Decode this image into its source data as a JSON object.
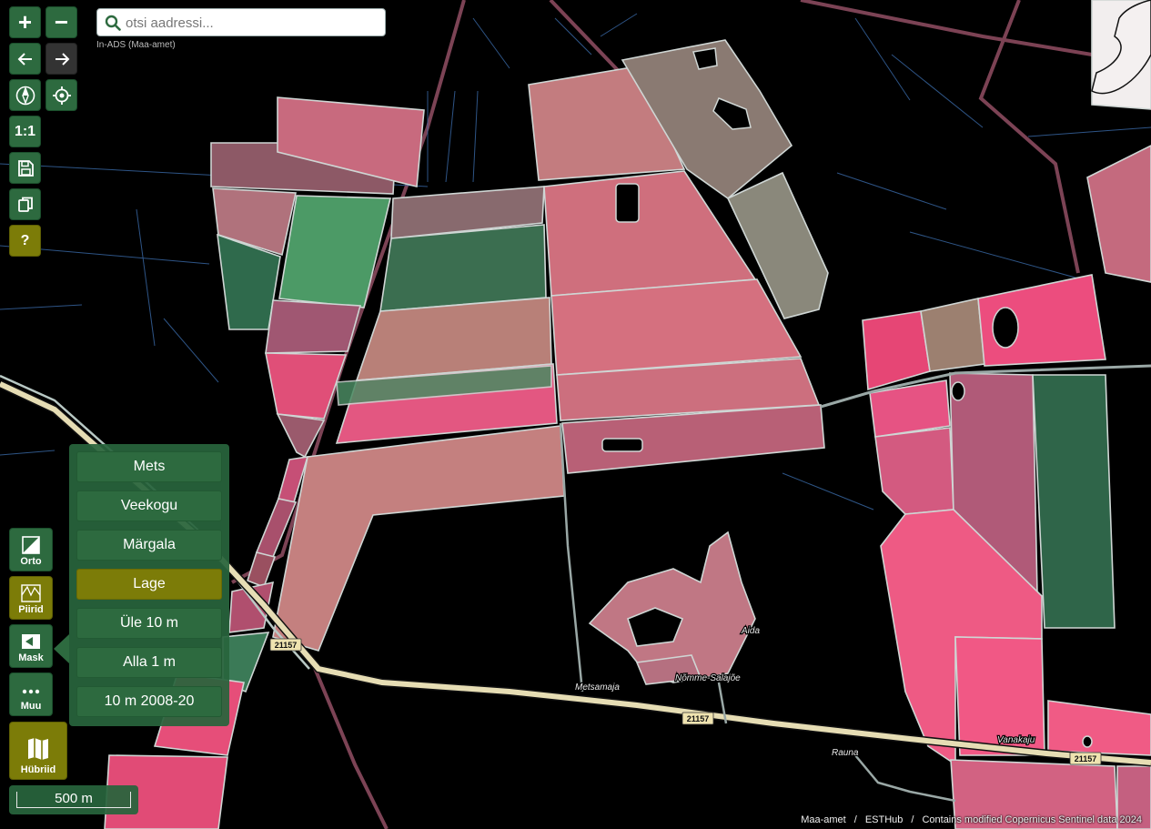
{
  "search": {
    "placeholder": "otsi aadressi...",
    "source_label": "In-ADS (Maa-amet)"
  },
  "toolbar": {
    "zoom_in": "+",
    "zoom_out": "−",
    "scale_reset_label": "1:1",
    "help_label": "?"
  },
  "layers": [
    {
      "label": "Orto",
      "icon": "ortho-icon"
    },
    {
      "label": "Piirid",
      "icon": "boundaries-icon"
    },
    {
      "label": "Mask",
      "icon": "mask-icon"
    },
    {
      "label": "Muu",
      "icon": "more-icon"
    },
    {
      "label": "Hübriid",
      "icon": "map-icon"
    }
  ],
  "mask_panel": {
    "options": [
      "Mets",
      "Veekogu",
      "Märgala",
      "Lage",
      "Üle 10 m",
      "Alla 1 m",
      "10 m 2008-20"
    ],
    "active": "Lage"
  },
  "scale": {
    "label": "500 m"
  },
  "attribution": {
    "items": [
      "Maa-amet",
      "ESTHub",
      "Contains modified Copernicus Sentinel data 2024"
    ]
  },
  "map_labels": {
    "road_number": "21157",
    "places": [
      "Aida",
      "Nõmme-Salajõe",
      "Metsamaja",
      "Vanakaju",
      "Rauna"
    ]
  },
  "colors": {
    "button_green": "#2d6a3f",
    "button_olive": "#7c7c08",
    "field_pink": "#e45a82",
    "field_green": "#3f7c57",
    "road": "#e6ddb4",
    "boundary": "#8a4a5e"
  }
}
